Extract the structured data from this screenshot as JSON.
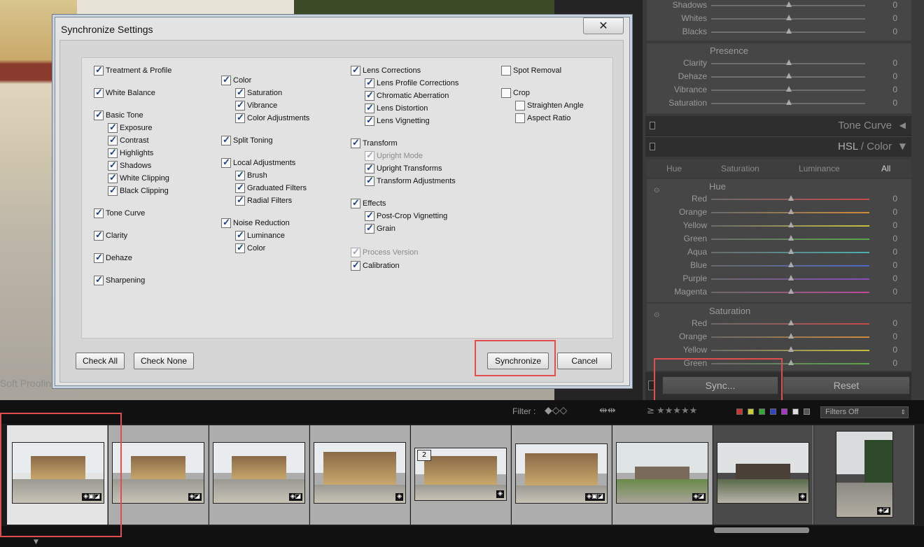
{
  "dialog": {
    "title": "Synchronize Settings",
    "close_glyph": "✕",
    "col1": [
      {
        "label": "Treatment & Profile",
        "checked": true
      },
      {
        "label": "White Balance",
        "checked": true
      },
      {
        "label": "Basic Tone",
        "checked": true
      },
      {
        "label": "Exposure",
        "checked": true
      },
      {
        "label": "Contrast",
        "checked": true
      },
      {
        "label": "Highlights",
        "checked": true
      },
      {
        "label": "Shadows",
        "checked": true
      },
      {
        "label": "White Clipping",
        "checked": true
      },
      {
        "label": "Black Clipping",
        "checked": true
      },
      {
        "label": "Tone Curve",
        "checked": true
      },
      {
        "label": "Clarity",
        "checked": true
      },
      {
        "label": "Dehaze",
        "checked": true
      },
      {
        "label": "Sharpening",
        "checked": true
      }
    ],
    "col2": [
      {
        "label": "Color",
        "checked": true
      },
      {
        "label": "Saturation",
        "checked": true
      },
      {
        "label": "Vibrance",
        "checked": true
      },
      {
        "label": "Color Adjustments",
        "checked": true
      },
      {
        "label": "Split Toning",
        "checked": true
      },
      {
        "label": "Local Adjustments",
        "checked": true
      },
      {
        "label": "Brush",
        "checked": true
      },
      {
        "label": "Graduated Filters",
        "checked": true
      },
      {
        "label": "Radial Filters",
        "checked": true
      },
      {
        "label": "Noise Reduction",
        "checked": true
      },
      {
        "label": "Luminance",
        "checked": true
      },
      {
        "label": "Color",
        "checked": true
      }
    ],
    "col3": [
      {
        "label": "Lens Corrections",
        "checked": true
      },
      {
        "label": "Lens Profile Corrections",
        "checked": true
      },
      {
        "label": "Chromatic Aberration",
        "checked": true
      },
      {
        "label": "Lens Distortion",
        "checked": true
      },
      {
        "label": "Lens Vignetting",
        "checked": true
      },
      {
        "label": "Transform",
        "checked": true
      },
      {
        "label": "Upright Mode",
        "checked": true,
        "disabled": true
      },
      {
        "label": "Upright Transforms",
        "checked": true
      },
      {
        "label": "Transform Adjustments",
        "checked": true
      },
      {
        "label": "Effects",
        "checked": true
      },
      {
        "label": "Post-Crop Vignetting",
        "checked": true
      },
      {
        "label": "Grain",
        "checked": true
      },
      {
        "label": "Process Version",
        "checked": true,
        "disabled": true
      },
      {
        "label": "Calibration",
        "checked": true
      }
    ],
    "col4": [
      {
        "label": "Spot Removal",
        "checked": false
      },
      {
        "label": "Crop",
        "checked": false
      },
      {
        "label": "Straighten Angle",
        "checked": false
      },
      {
        "label": "Aspect Ratio",
        "checked": false
      }
    ],
    "buttons": {
      "check_all": "Check All",
      "check_none": "Check None",
      "synchronize": "Synchronize",
      "cancel": "Cancel"
    }
  },
  "right_panel": {
    "tone_rows": [
      {
        "label": "Shadows",
        "value": "0"
      },
      {
        "label": "Whites",
        "value": "0"
      },
      {
        "label": "Blacks",
        "value": "0"
      }
    ],
    "presence": {
      "title": "Presence",
      "rows": [
        {
          "label": "Clarity",
          "value": "0"
        },
        {
          "label": "Dehaze",
          "value": "0"
        },
        {
          "label": "Vibrance",
          "value": "0"
        },
        {
          "label": "Saturation",
          "value": "0"
        }
      ]
    },
    "tone_curve_title": "Tone Curve",
    "hsl_title": "HSL",
    "hsl_sep": "/",
    "color_title": "Color",
    "tabs": [
      "Hue",
      "Saturation",
      "Luminance",
      "All"
    ],
    "hue": {
      "title": "Hue",
      "rows": [
        {
          "label": "Red",
          "value": "0",
          "color": "#c84a4a"
        },
        {
          "label": "Orange",
          "value": "0",
          "color": "#d08a3a"
        },
        {
          "label": "Yellow",
          "value": "0",
          "color": "#c8c040"
        },
        {
          "label": "Green",
          "value": "0",
          "color": "#5aa84a"
        },
        {
          "label": "Aqua",
          "value": "0",
          "color": "#4ab0b0"
        },
        {
          "label": "Blue",
          "value": "0",
          "color": "#4a6ac8"
        },
        {
          "label": "Purple",
          "value": "0",
          "color": "#8a4ac0"
        },
        {
          "label": "Magenta",
          "value": "0",
          "color": "#c04a9a"
        }
      ]
    },
    "saturation": {
      "title": "Saturation",
      "rows": [
        {
          "label": "Red",
          "value": "0",
          "color": "#c84a4a"
        },
        {
          "label": "Orange",
          "value": "0",
          "color": "#d08a3a"
        },
        {
          "label": "Yellow",
          "value": "0",
          "color": "#c8c040"
        },
        {
          "label": "Green",
          "value": "0",
          "color": "#5aa84a"
        }
      ]
    },
    "sync_label": "Sync...",
    "reset_label": "Reset"
  },
  "soft_proofing": "Soft Proofing",
  "filter": {
    "label": "Filter :",
    "rating_op": "≥",
    "stars": "★★★★★",
    "dropdown": "Filters Off"
  },
  "filmstrip": {
    "stack_count": "2"
  }
}
